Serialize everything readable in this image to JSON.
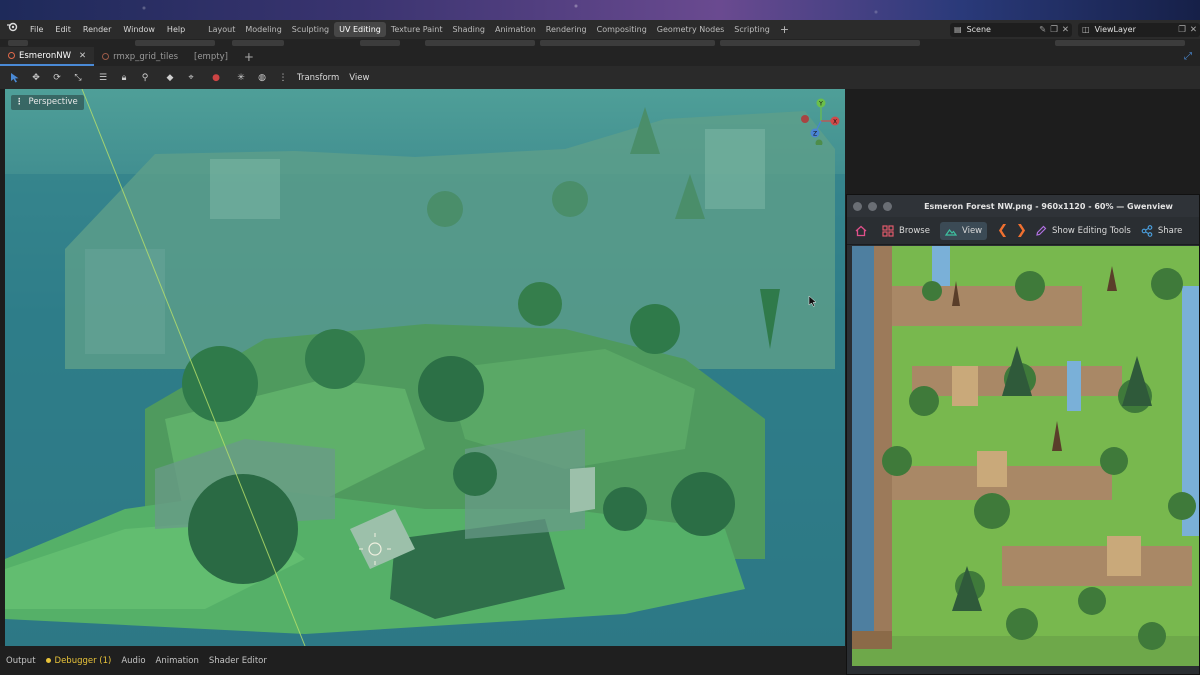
{
  "menus": [
    "File",
    "Edit",
    "Render",
    "Window",
    "Help"
  ],
  "workspaces": [
    "Layout",
    "Modeling",
    "Sculpting",
    "UV Editing",
    "Texture Paint",
    "Shading",
    "Animation",
    "Rendering",
    "Compositing",
    "Geometry Nodes",
    "Scripting"
  ],
  "active_workspace": "UV Editing",
  "scene": "Scene",
  "view_layer": "ViewLayer",
  "file_tabs": [
    {
      "label": "EsmeronNW",
      "active": true
    },
    {
      "label": "rmxp_grid_tiles",
      "active": false
    },
    {
      "label": "[empty]",
      "active": false
    }
  ],
  "toolbar": {
    "transform": "Transform",
    "view": "View"
  },
  "viewport": {
    "mode_label": "Perspective",
    "axes": [
      "Y",
      "X",
      "Z"
    ]
  },
  "bottom_tabs": [
    "Output",
    "Debugger (1)",
    "Audio",
    "Animation",
    "Shader Editor"
  ],
  "gwenview": {
    "title": "Esmeron Forest NW.png - 960x1120 - 60% — Gwenview",
    "toolbar": [
      "Browse",
      "View",
      "Show Editing Tools",
      "Share"
    ],
    "active_tool": "View"
  },
  "colors": {
    "accent_blue": "#4a8ad6",
    "sky_teal": "#3f8c8f",
    "grass": "#6aa64a",
    "debug_dot": "#e8c33a"
  }
}
